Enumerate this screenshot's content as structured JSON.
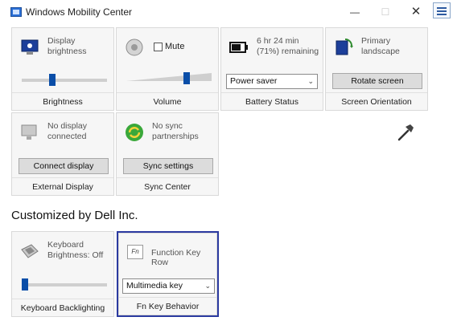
{
  "window": {
    "title": "Windows Mobility Center",
    "min_glyph": "—",
    "max_glyph": "☐",
    "close_glyph": "✕"
  },
  "tiles": {
    "brightness": {
      "text": "Display brightness",
      "footer": "Brightness",
      "level_percent": 35
    },
    "volume": {
      "mute_label": "Mute",
      "muted": false,
      "footer": "Volume",
      "level_percent": 72
    },
    "battery": {
      "text": "6 hr 24 min (71%) remaining",
      "plan": "Power saver",
      "footer": "Battery Status"
    },
    "orientation": {
      "text": "Primary landscape",
      "button": "Rotate screen",
      "footer": "Screen Orientation"
    },
    "external_display": {
      "text": "No display connected",
      "button": "Connect display",
      "footer": "External Display"
    },
    "sync": {
      "text": "No sync partnerships",
      "button": "Sync settings",
      "footer": "Sync Center"
    }
  },
  "customized_heading": "Customized by Dell Inc.",
  "dell_tiles": {
    "keyboard": {
      "text": "Keyboard Brightness: Off",
      "footer": "Keyboard Backlighting",
      "level_percent": 0
    },
    "fn_key": {
      "icon_label": "Fn",
      "text": "Function Key Row",
      "select": "Multimedia key",
      "footer": "Fn Key Behavior"
    }
  },
  "colors": {
    "accent": "#0a4ea8",
    "highlight_border": "#2b3aa0"
  }
}
